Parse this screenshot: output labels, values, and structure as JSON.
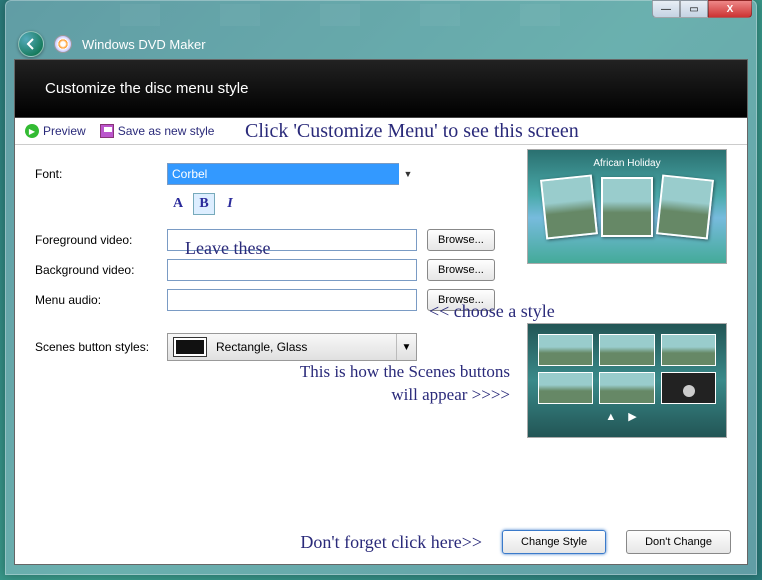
{
  "app": {
    "title": "Windows DVD Maker"
  },
  "header": {
    "title": "Customize the disc menu style"
  },
  "toolbar": {
    "preview_label": "Preview",
    "save_label": "Save as new style"
  },
  "annotations": {
    "top": "Click 'Customize Menu' to see this screen",
    "leave": "Leave these",
    "choose": "<< choose a style",
    "scenes_line1": "This is how the Scenes buttons",
    "scenes_line2": "will appear >>>>",
    "footer": "Don't forget click here>>"
  },
  "form": {
    "font_label": "Font:",
    "font_value": "Corbel",
    "fg_video_label": "Foreground video:",
    "fg_video_value": "",
    "bg_video_label": "Background video:",
    "bg_video_value": "",
    "audio_label": "Menu audio:",
    "audio_value": "",
    "scenes_label": "Scenes button styles:",
    "scenes_value": "Rectangle, Glass",
    "browse_label": "Browse..."
  },
  "preview": {
    "title": "African Holiday"
  },
  "footer": {
    "change_label": "Change Style",
    "cancel_label": "Don't Change"
  },
  "window_controls": {
    "min": "—",
    "max": "▭",
    "close": "X"
  },
  "fontstyle": {
    "normal": "A",
    "bold": "B",
    "italic": "I"
  }
}
